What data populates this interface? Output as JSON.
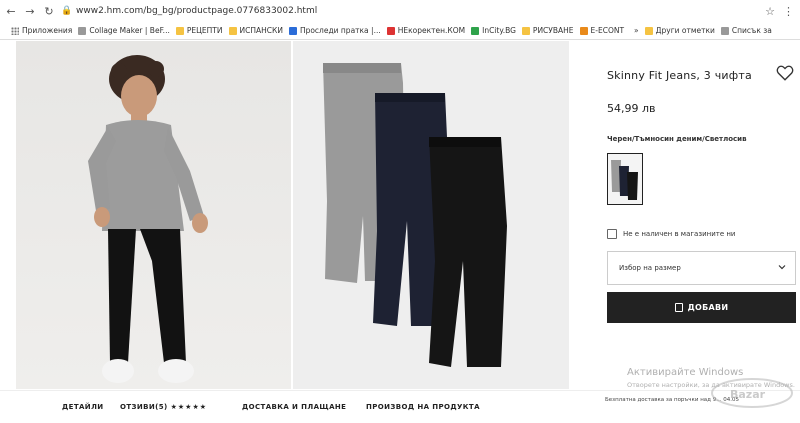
{
  "browser": {
    "url": "www2.hm.com/bg_bg/productpage.0776833002.html"
  },
  "bookmarks": {
    "items": [
      "Приложения",
      "Collage Maker | BeF...",
      "РЕЦЕПТИ",
      "ИСПАНСКИ",
      "Проследи пратка |...",
      "НЕкоректен.КОМ",
      "InCity.BG",
      "РИСУВАНЕ",
      "E-ECONT"
    ],
    "more": "»",
    "other_bookmarks": "Други отметки",
    "reading_list": "Списък за"
  },
  "watermark_logo_text": "Bazar",
  "product": {
    "title": "Skinny Fit Jeans, 3 чифта",
    "price": "54,99 лв",
    "color_label": "Черен/Тъмносин деним/Светлосив",
    "stock_text": "Не е наличен в магазините ни",
    "size_placeholder": "Избор на размер",
    "add_button": "ДОБАВИ"
  },
  "bottom_nav": {
    "details": "ДЕТАЙЛИ",
    "reviews": "ОТЗИВИ(5)",
    "stars": "★★★★★",
    "delivery": "ДОСТАВКА И ПЛАЩАНЕ",
    "production": "ПРОИЗВОД НА ПРОДУКТА",
    "promo": "Безплатна доставка за поръчки над 9... 04.05"
  },
  "windows_activation": {
    "title": "Активирайте Windows",
    "subtitle": "Отворете настройки, за да активирате Windows."
  },
  "colors": {
    "accent": "#222222",
    "light_gray_jeans": "#9a9a9a",
    "navy_jeans": "#1e2233",
    "black_jeans": "#151515"
  }
}
